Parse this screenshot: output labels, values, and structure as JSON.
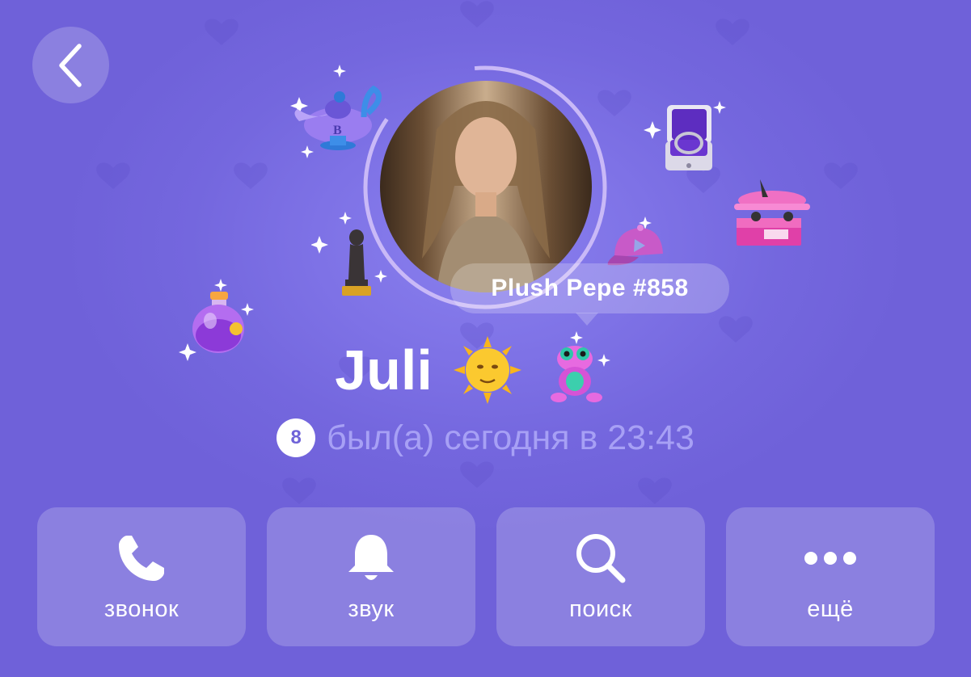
{
  "colors": {
    "accent": "#7e72e6",
    "status_text": "#a7a0f5",
    "button_bg": "rgba(255,255,255,0.2)"
  },
  "header": {
    "back_icon": "chevron-left-icon"
  },
  "profile": {
    "name": "Juli",
    "emoji_status": "🌞",
    "level": "8",
    "status": "был(а) сегодня в 23:43",
    "gift_tooltip": "Plush Pepe #858",
    "gifts": [
      "magic-lamp-icon",
      "ring-box-icon",
      "toy-airplane-icon",
      "cap-icon",
      "statuette-icon",
      "potion-icon",
      "plush-pepe-icon"
    ]
  },
  "actions": [
    {
      "label": "звонок",
      "icon": "phone-icon"
    },
    {
      "label": "звук",
      "icon": "bell-icon"
    },
    {
      "label": "поиск",
      "icon": "search-icon"
    },
    {
      "label": "ещё",
      "icon": "more-icon"
    }
  ]
}
